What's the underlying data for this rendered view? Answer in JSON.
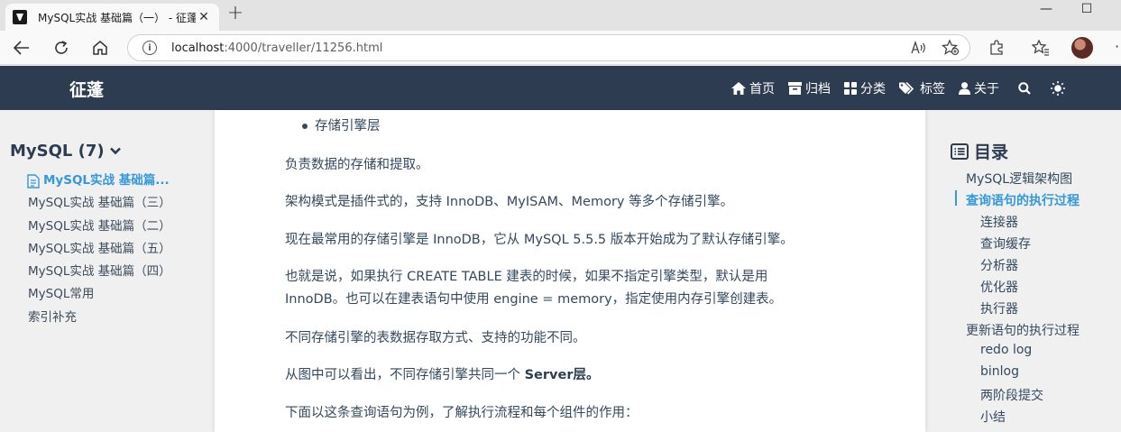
{
  "browser": {
    "tab_title": "MySQL实战 基础篇（一） - 征蓬",
    "url_host": "localhost",
    "url_path": ":4000/traveller/11256.html",
    "window_minimize": "—",
    "window_maximize": "☐"
  },
  "site": {
    "brand": "征蓬",
    "menu": [
      {
        "label": "首页",
        "icon": "home-icon"
      },
      {
        "label": "归档",
        "icon": "archive-icon"
      },
      {
        "label": "分类",
        "icon": "grid-icon"
      },
      {
        "label": "标签",
        "icon": "tags-icon"
      },
      {
        "label": "关于",
        "icon": "user-icon"
      }
    ]
  },
  "sidebar": {
    "category": "MySQL (7)",
    "posts": [
      "MySQL实战 基础篇...",
      "MySQL实战 基础篇（三）",
      "MySQL实战 基础篇（二）",
      "MySQL实战 基础篇（五）",
      "MySQL实战 基础篇（四）",
      "MySQL常用",
      "索引补充"
    ]
  },
  "article": {
    "bullet": "存储引擎层",
    "p1": "负责数据的存储和提取。",
    "p2": "架构模式是插件式的，支持 InnoDB、MyISAM、Memory 等多个存储引擎。",
    "p3": "现在最常用的存储引擎是 InnoDB，它从 MySQL 5.5.5 版本开始成为了默认存储引擎。",
    "p4a": "也就是说，如果执行 CREATE TABLE 建表的时候，如果不指定引擎类型，默认是用",
    "p4b": "InnoDB。也可以在建表语句中使用 engine = memory，指定使用内存引擎创建表。",
    "p5": "不同存储引擎的表数据存取方式、支持的功能不同。",
    "p6_pre": "从图中可以看出，不同存储引擎共同一个 ",
    "p6_bold": "Server层。",
    "p7": "下面以这条查询语句为例，了解执行流程和每个组件的作用："
  },
  "toc": {
    "title": "目录",
    "items": [
      "MySQL逻辑架构图",
      "查询语句的执行过程",
      "连接器",
      "查询缓存",
      "分析器",
      "优化器",
      "执行器",
      "更新语句的执行过程",
      "redo log",
      "binlog",
      "两阶段提交",
      "小结"
    ]
  },
  "colors": {
    "header_bg": "#2d3c50",
    "accent": "#3498db",
    "text": "#34495e"
  }
}
